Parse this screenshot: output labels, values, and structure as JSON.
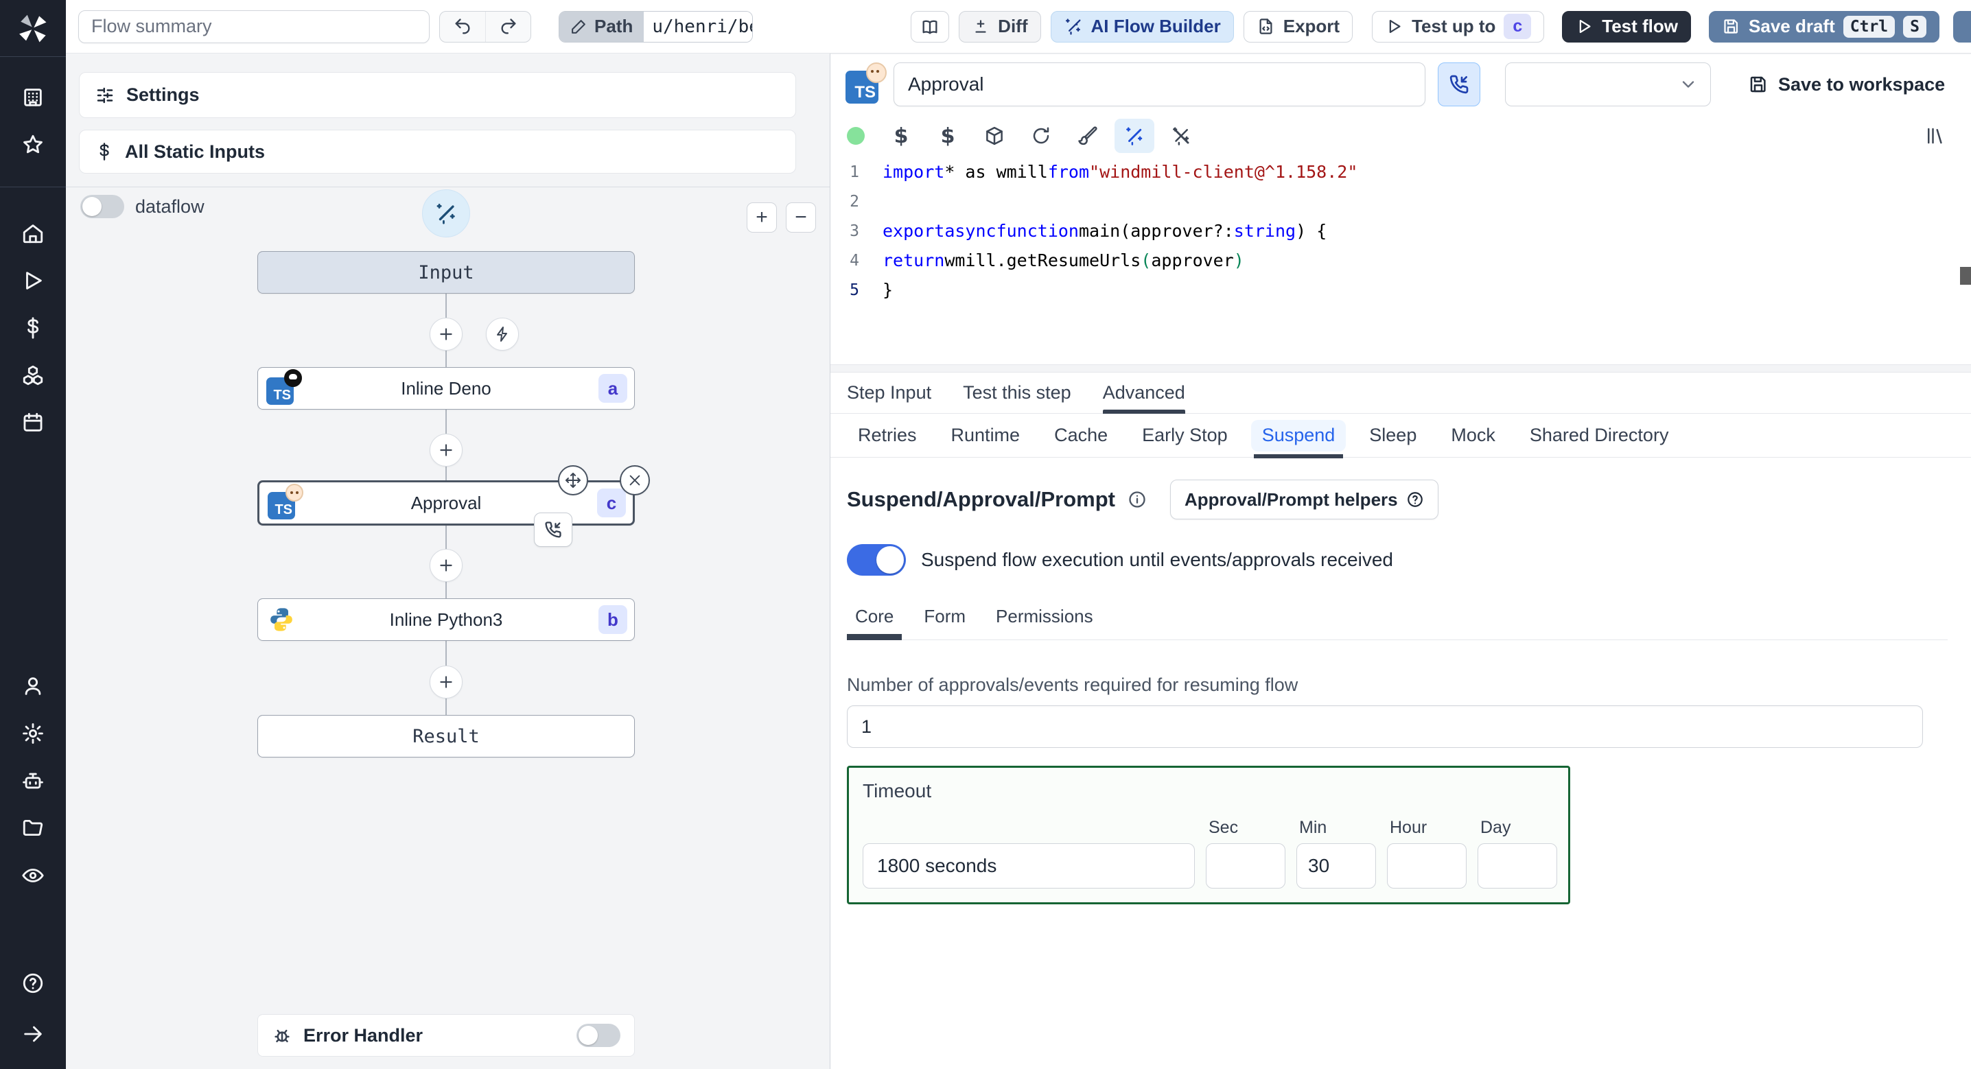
{
  "topbar": {
    "flow_summary_placeholder": "Flow summary",
    "path_label": "Path",
    "path_value": "u/henri/bes",
    "diff_label": "Diff",
    "ai_flow_builder_label": "AI Flow Builder",
    "export_label": "Export",
    "test_up_to_label": "Test up to",
    "test_up_to_badge": "c",
    "test_flow_label": "Test flow",
    "save_draft_label": "Save draft",
    "save_draft_kbd_ctrl": "Ctrl",
    "save_draft_kbd_s": "S",
    "icons": [
      "undo-icon",
      "redo-icon",
      "pencil-icon",
      "book-open-icon",
      "diff-icon",
      "wand-sparkles-icon",
      "file-export-icon",
      "play-icon",
      "save-icon"
    ]
  },
  "sidebar": {
    "icons": [
      "windmill-logo",
      "building-icon",
      "star-icon",
      "home-icon",
      "play-icon",
      "dollar-icon",
      "boxes-icon",
      "calendar-icon",
      "user-icon",
      "gear-icon",
      "robot-icon",
      "folder-icon",
      "eye-icon",
      "help-icon",
      "arrow-right-icon"
    ]
  },
  "flow_panel": {
    "settings_label": "Settings",
    "static_inputs_label": "All Static Inputs",
    "dataflow_label": "dataflow",
    "zoom_in_label": "+",
    "zoom_out_label": "−",
    "nodes": {
      "input": {
        "label": "Input"
      },
      "deno": {
        "label": "Inline Deno",
        "badge": "a",
        "language": "TS"
      },
      "approval": {
        "label": "Approval",
        "badge": "c",
        "language": "TS"
      },
      "python": {
        "label": "Inline Python3",
        "badge": "b",
        "language": "Python"
      },
      "result": {
        "label": "Result"
      }
    },
    "error_handler_label": "Error Handler"
  },
  "step_panel": {
    "language": "TS",
    "name_value": "Approval",
    "save_to_workspace_label": "Save to workspace",
    "toolbar_icons": [
      "status-dot",
      "dollar-icon",
      "dollar-icon",
      "package-icon",
      "rotate-icon",
      "brush-icon",
      "wand-icon",
      "wand-off-icon",
      "library-icon"
    ],
    "editor": {
      "lines": [
        [
          {
            "c": "kw",
            "t": "import"
          },
          {
            "c": "pl",
            "t": " * as wmill "
          },
          {
            "c": "kw",
            "t": "from"
          },
          {
            "c": "pl",
            "t": " "
          },
          {
            "c": "str",
            "t": "\"windmill-client@^1.158.2\""
          }
        ],
        [],
        [
          {
            "c": "kw",
            "t": "export"
          },
          {
            "c": "pl",
            "t": " "
          },
          {
            "c": "kw",
            "t": "async"
          },
          {
            "c": "pl",
            "t": " "
          },
          {
            "c": "kw",
            "t": "function"
          },
          {
            "c": "pl",
            "t": " main(approver?: "
          },
          {
            "c": "kw",
            "t": "string"
          },
          {
            "c": "pl",
            "t": ") {"
          }
        ],
        [
          {
            "c": "pl",
            "t": "  "
          },
          {
            "c": "kw",
            "t": "return"
          },
          {
            "c": "pl",
            "t": " wmill.getResumeUrls"
          },
          {
            "c": "paren",
            "t": "("
          },
          {
            "c": "pl",
            "t": "approver"
          },
          {
            "c": "paren",
            "t": ")"
          }
        ],
        [
          {
            "c": "pl",
            "t": "}"
          }
        ]
      ]
    },
    "tabs": [
      {
        "label": "Step Input",
        "active": false
      },
      {
        "label": "Test this step",
        "active": false
      },
      {
        "label": "Advanced",
        "active": true
      }
    ],
    "subtabs": [
      {
        "label": "Retries",
        "active": false
      },
      {
        "label": "Runtime",
        "active": false
      },
      {
        "label": "Cache",
        "active": false
      },
      {
        "label": "Early Stop",
        "active": false
      },
      {
        "label": "Suspend",
        "active": true
      },
      {
        "label": "Sleep",
        "active": false
      },
      {
        "label": "Mock",
        "active": false
      },
      {
        "label": "Shared Directory",
        "active": false
      }
    ],
    "suspend": {
      "heading": "Suspend/Approval/Prompt",
      "helpers_label": "Approval/Prompt helpers",
      "toggle_label": "Suspend flow execution until events/approvals received",
      "toggle_on": true,
      "inner_tabs": [
        {
          "label": "Core",
          "active": true
        },
        {
          "label": "Form",
          "active": false
        },
        {
          "label": "Permissions",
          "active": false
        }
      ],
      "approvals_label": "Number of approvals/events required for resuming flow",
      "approvals_value": "1",
      "timeout": {
        "label": "Timeout",
        "value": "1800 seconds",
        "units": [
          {
            "label": "Sec",
            "value": ""
          },
          {
            "label": "Min",
            "value": "30"
          },
          {
            "label": "Hour",
            "value": ""
          },
          {
            "label": "Day",
            "value": ""
          }
        ]
      }
    }
  },
  "colors": {
    "sidebar_bg": "#1c212c",
    "panel_bg": "#f3f4f6",
    "accent_blue": "#2563eb",
    "toggle_on": "#3b6be4",
    "save_draft": "#5f7da3",
    "test_flow": "#272e3b",
    "badge_bg": "#e0e7ff",
    "badge_text": "#4338ca",
    "timeout_border": "#166534",
    "status_dot": "#86e29b",
    "ts_logo": "#3178c6"
  }
}
